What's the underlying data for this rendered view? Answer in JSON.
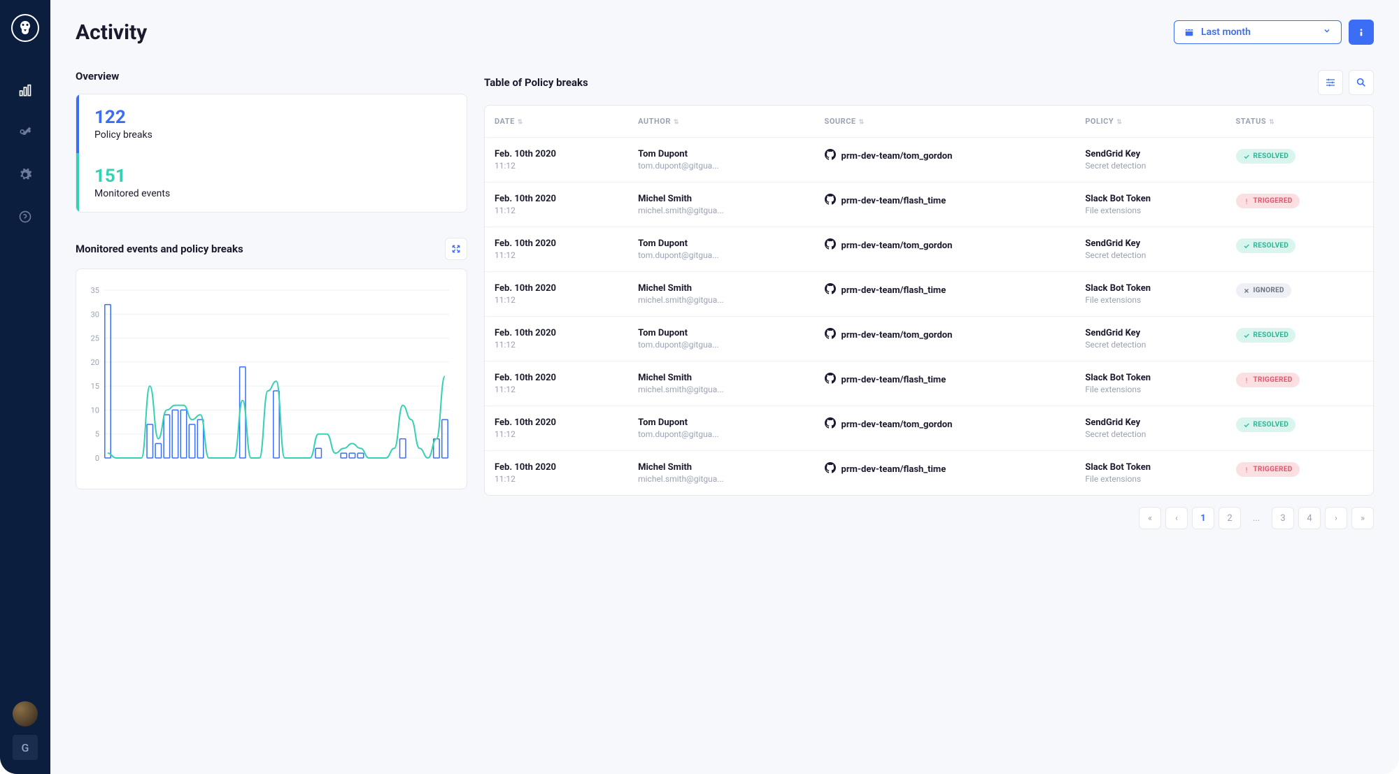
{
  "page": {
    "title": "Activity"
  },
  "date_filter": {
    "label": "Last month"
  },
  "overview": {
    "title": "Overview",
    "policy_breaks": {
      "value": "122",
      "label": "Policy breaks"
    },
    "monitored_events": {
      "value": "151",
      "label": "Monitored events"
    }
  },
  "chart": {
    "title": "Monitored events and policy breaks"
  },
  "chart_data": {
    "type": "bar",
    "ylim": [
      0,
      35
    ],
    "yticks": [
      0,
      5,
      10,
      15,
      20,
      25,
      30,
      35
    ],
    "series": [
      {
        "name": "Policy breaks",
        "type": "bar",
        "values": [
          32,
          0,
          0,
          0,
          0,
          7,
          3,
          9,
          10,
          10,
          7,
          8,
          0,
          0,
          0,
          0,
          19,
          0,
          0,
          0,
          14,
          0,
          0,
          0,
          0,
          2,
          0,
          0,
          1,
          1,
          1,
          0,
          0,
          0,
          0,
          4,
          0,
          0,
          0,
          4,
          8
        ]
      },
      {
        "name": "Monitored events",
        "type": "line",
        "values": [
          1,
          0,
          0,
          0,
          0,
          15,
          4,
          10,
          11,
          11,
          8,
          9,
          0,
          0,
          0,
          0,
          12,
          0,
          0,
          14,
          16,
          0,
          0,
          0,
          0,
          5,
          5,
          1,
          2,
          3,
          2,
          0,
          0,
          0,
          2,
          11,
          8,
          2,
          0,
          4,
          17
        ]
      }
    ]
  },
  "table": {
    "title": "Table of Policy breaks",
    "columns": {
      "date": "DATE",
      "author": "AUTHOR",
      "source": "SOURCE",
      "policy": "POLICY",
      "status": "STATUS"
    },
    "rows": [
      {
        "date": "Feb. 10th 2020",
        "time": "11:12",
        "author": "Tom Dupont",
        "email": "tom.dupont@gitgua...",
        "source": "prm-dev-team/tom_gordon",
        "policy": "SendGrid Key",
        "policy_sub": "Secret detection",
        "status": "RESOLVED",
        "status_type": "resolved"
      },
      {
        "date": "Feb. 10th 2020",
        "time": "11:12",
        "author": "Michel Smith",
        "email": "michel.smith@gitgua...",
        "source": "prm-dev-team/flash_time",
        "policy": "Slack Bot Token",
        "policy_sub": "File extensions",
        "status": "TRIGGERED",
        "status_type": "triggered"
      },
      {
        "date": "Feb. 10th 2020",
        "time": "11:12",
        "author": "Tom Dupont",
        "email": "tom.dupont@gitgua...",
        "source": "prm-dev-team/tom_gordon",
        "policy": "SendGrid Key",
        "policy_sub": "Secret detection",
        "status": "RESOLVED",
        "status_type": "resolved"
      },
      {
        "date": "Feb. 10th 2020",
        "time": "11:12",
        "author": "Michel Smith",
        "email": "michel.smith@gitgua...",
        "source": "prm-dev-team/flash_time",
        "policy": "Slack Bot Token",
        "policy_sub": "File extensions",
        "status": "IGNORED",
        "status_type": "ignored"
      },
      {
        "date": "Feb. 10th 2020",
        "time": "11:12",
        "author": "Tom Dupont",
        "email": "tom.dupont@gitgua...",
        "source": "prm-dev-team/tom_gordon",
        "policy": "SendGrid Key",
        "policy_sub": "Secret detection",
        "status": "RESOLVED",
        "status_type": "resolved"
      },
      {
        "date": "Feb. 10th 2020",
        "time": "11:12",
        "author": "Michel Smith",
        "email": "michel.smith@gitgua...",
        "source": "prm-dev-team/flash_time",
        "policy": "Slack Bot Token",
        "policy_sub": "File extensions",
        "status": "TRIGGERED",
        "status_type": "triggered"
      },
      {
        "date": "Feb. 10th 2020",
        "time": "11:12",
        "author": "Tom Dupont",
        "email": "tom.dupont@gitgua...",
        "source": "prm-dev-team/tom_gordon",
        "policy": "SendGrid Key",
        "policy_sub": "Secret detection",
        "status": "RESOLVED",
        "status_type": "resolved"
      },
      {
        "date": "Feb. 10th 2020",
        "time": "11:12",
        "author": "Michel Smith",
        "email": "michel.smith@gitgua...",
        "source": "prm-dev-team/flash_time",
        "policy": "Slack Bot Token",
        "policy_sub": "File extensions",
        "status": "TRIGGERED",
        "status_type": "triggered"
      }
    ]
  },
  "pagination": {
    "pages": [
      "1",
      "2",
      "...",
      "3",
      "4"
    ],
    "active": "1"
  },
  "avatar_letter": "G"
}
